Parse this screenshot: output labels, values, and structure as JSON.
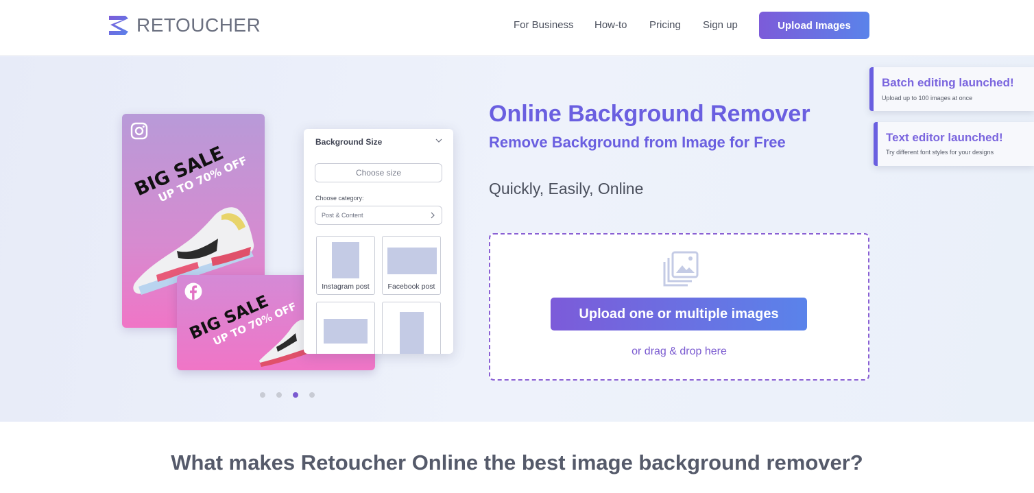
{
  "brand": {
    "name": "RETOUCHER",
    "accent": "#6a5fe0",
    "gradient_start": "#7c5bd9",
    "gradient_end": "#5a83ea"
  },
  "nav": {
    "items": [
      "For Business",
      "How-to",
      "Pricing",
      "Sign up"
    ],
    "cta": "Upload Images"
  },
  "mockup": {
    "instagram_icon": "instagram-icon",
    "facebook_icon": "facebook-icon",
    "sale_headline": "BIG SALE",
    "sale_discount": "UP TO 70% OFF",
    "panel": {
      "title": "Background Size",
      "size_placeholder": "Choose size",
      "category_label": "Choose category:",
      "category_value": "Post & Content",
      "tiles": [
        "Instagram post",
        "Facebook post",
        "",
        ""
      ]
    },
    "carousel_active_index": 2,
    "carousel_count": 4
  },
  "hero": {
    "title": "Online Background Remover",
    "subtitle": "Remove Background from Image for Free",
    "tagline": "Quickly, Easily, Online",
    "upload_button": "Upload one or multiple images",
    "drag_text": "or drag & drop here"
  },
  "notices": [
    {
      "title": "Batch editing launched!",
      "text": "Upload up to 100 images at once"
    },
    {
      "title": "Text editor launched!",
      "text": "Try different font styles for your designs"
    }
  ],
  "section": {
    "title": "What makes Retoucher Online the best image background remover?"
  }
}
